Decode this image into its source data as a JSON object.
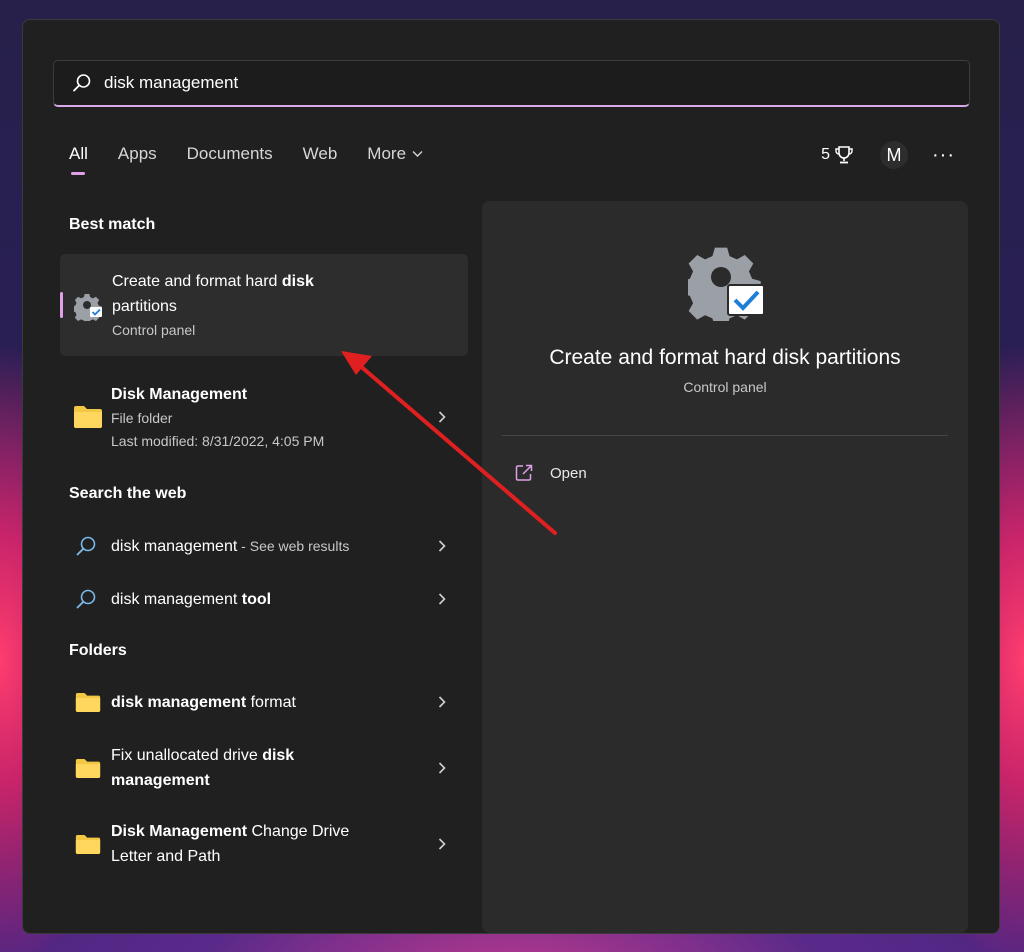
{
  "search": {
    "query": "disk management"
  },
  "tabs": [
    {
      "label": "All"
    },
    {
      "label": "Apps"
    },
    {
      "label": "Documents"
    },
    {
      "label": "Web"
    },
    {
      "label": "More"
    }
  ],
  "header": {
    "points": "5",
    "avatar_initial": "M",
    "more_options": "···"
  },
  "sections": {
    "best_match": "Best match",
    "search_web": "Search the web",
    "folders": "Folders"
  },
  "best_match": {
    "line1_normal": "Create and format hard ",
    "line1_bold": "disk",
    "line2": "partitions",
    "subtitle": "Control panel"
  },
  "disk_management": {
    "title": "Disk Management",
    "type": "File folder",
    "modified": "Last modified: 8/31/2022, 4:05 PM"
  },
  "web_results": [
    {
      "main": "disk management",
      "suffix": " - See web results"
    },
    {
      "main": "disk management ",
      "bold": "tool"
    }
  ],
  "folders": [
    {
      "bold": "disk management",
      "normal": " format"
    },
    {
      "normal": "Fix unallocated drive ",
      "bold": "disk",
      "line2_bold": "management"
    },
    {
      "bold": "Disk Management",
      "normal": " Change Drive",
      "line2": "Letter and Path"
    }
  ],
  "preview": {
    "title": "Create and format hard disk partitions",
    "subtitle": "Control panel",
    "open_label": "Open"
  },
  "colors": {
    "accent": "#e0a0e8",
    "annotation_arrow": "#e02020",
    "folder": "#f2c744",
    "search_icon": "#7ab8e8"
  },
  "icons": [
    "search-icon",
    "trophy-icon",
    "chevron-down-icon",
    "settings-icon",
    "folder-icon",
    "chevron-right-icon",
    "open-external-icon"
  ]
}
